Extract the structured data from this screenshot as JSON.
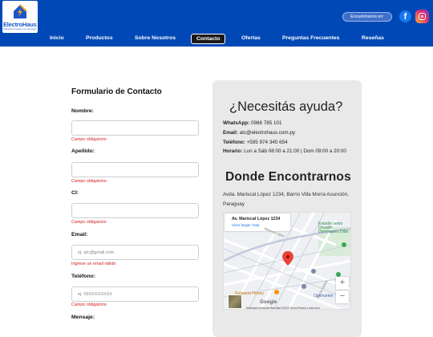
{
  "brand": {
    "name": "ElectroHaus",
    "tagline": "Todo para tu hogar en un solo lugar",
    "color": "#0048b5"
  },
  "header": {
    "social_label": "Encuéntranos en:",
    "facebook_icon": "facebook-icon",
    "instagram_icon": "instagram-icon"
  },
  "nav": {
    "items": [
      "Inicio",
      "Productos",
      "Sobre Nosotros",
      "Contacto",
      "Ofertas",
      "Preguntas Frecuentes",
      "Reseñas"
    ],
    "active": "Contacto"
  },
  "form": {
    "title": "Formulario de Contacto",
    "fields": {
      "nombre": {
        "label": "Nombre:",
        "value": "",
        "placeholder": "",
        "error": "Campo obligatorio"
      },
      "apellido": {
        "label": "Apellido:",
        "value": "",
        "placeholder": "",
        "error": "Campo obligatorio"
      },
      "ci": {
        "label": "CI:",
        "value": "",
        "placeholder": "",
        "error": "Campo obligatorio"
      },
      "email": {
        "label": "Email:",
        "value": "",
        "placeholder": "ej: atc@gmail.com",
        "error": "Ingrese un email válido"
      },
      "telefono": {
        "label": "Teléfono:",
        "value": "",
        "placeholder": "ej: 09XXXXXXXX",
        "error": "Campo obligatorio"
      },
      "mensaje": {
        "label": "Mensaje:"
      }
    }
  },
  "help": {
    "title": "¿Necesitás ayuda?",
    "whatsapp_label": "WhatsApp:",
    "whatsapp": "0986 785 101",
    "email_label": "Email:",
    "email": "atc@electrohaus.com.py",
    "phone_label": "Teléfono:",
    "phone": "+595 974 345 654",
    "hours_label": "Horario:",
    "hours": "Lun a Sáb 08:00 a 21:00 | Dom 09:00 a 20:00"
  },
  "location": {
    "title": "Donde Encontrarnos",
    "address": "Avda. Mariscal López 1234, Barrio Villa Morra Asunción, Paraguay",
    "map": {
      "place_title": "Av. Mariscal López 1234",
      "larger_map_link": "View larger map",
      "poi_stadium": "Estadio uenio Osvaldo Domínguez Dibb",
      "poi_shop": "Optimarket",
      "poi_food": "Rotisería Honey",
      "street_1": "Mariscal López",
      "street_2": "De los Santos",
      "google_label": "Google",
      "footer": "Keyboard shortcuts   Map data ©2025   Terms   Report a map error",
      "zoom_in": "+",
      "zoom_out": "−"
    }
  }
}
